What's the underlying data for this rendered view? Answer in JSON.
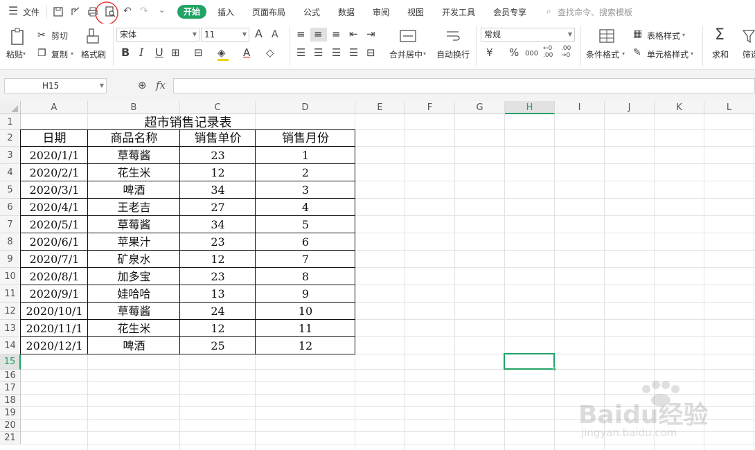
{
  "menubar": {
    "file_label": "文件",
    "tabs": [
      "开始",
      "插入",
      "页面布局",
      "公式",
      "数据",
      "审阅",
      "视图",
      "开发工具",
      "会员专享"
    ],
    "search_placeholder": "查找命令、搜索模板"
  },
  "ribbon": {
    "paste": "粘贴",
    "cut": "剪切",
    "copy": "复制",
    "format_painter": "格式刷",
    "font_name": "宋体",
    "font_size": "11",
    "bold": "B",
    "italic": "I",
    "underline": "U",
    "merge_center": "合并居中",
    "wrap_text": "自动换行",
    "number_format": "常规",
    "table_style": "表格样式",
    "cell_style": "单元格样式",
    "conditional_format": "条件格式",
    "sum": "求和",
    "filter": "筛选",
    "currency": "¥",
    "percent": "%",
    "thousands": "000",
    "dec_inc": "←0 .00",
    "dec_dec": ".00 →0",
    "font_grow": "A",
    "font_shrink": "A"
  },
  "formula_bar": {
    "name_box": "H15",
    "fx": "fx",
    "content": ""
  },
  "sheet": {
    "columns": [
      "A",
      "B",
      "C",
      "D",
      "E",
      "F",
      "G",
      "H",
      "I",
      "J",
      "K",
      "L"
    ],
    "rows": [
      "1",
      "2",
      "3",
      "4",
      "5",
      "6",
      "7",
      "8",
      "9",
      "10",
      "11",
      "12",
      "13",
      "14",
      "15",
      "16",
      "17",
      "18",
      "19",
      "20",
      "21"
    ],
    "active_cell": "H15",
    "title": "超市销售记录表",
    "headers": [
      "日期",
      "商品名称",
      "销售单价",
      "销售月份"
    ],
    "data": [
      [
        "2020/1/1",
        "草莓酱",
        "23",
        "1"
      ],
      [
        "2020/2/1",
        "花生米",
        "12",
        "2"
      ],
      [
        "2020/3/1",
        "啤酒",
        "34",
        "3"
      ],
      [
        "2020/4/1",
        "王老吉",
        "27",
        "4"
      ],
      [
        "2020/5/1",
        "草莓酱",
        "34",
        "5"
      ],
      [
        "2020/6/1",
        "苹果汁",
        "23",
        "6"
      ],
      [
        "2020/7/1",
        "矿泉水",
        "12",
        "7"
      ],
      [
        "2020/8/1",
        "加多宝",
        "23",
        "8"
      ],
      [
        "2020/9/1",
        "娃哈哈",
        "13",
        "9"
      ],
      [
        "2020/10/1",
        "草莓酱",
        "24",
        "10"
      ],
      [
        "2020/11/1",
        "花生米",
        "12",
        "11"
      ],
      [
        "2020/12/1",
        "啤酒",
        "25",
        "12"
      ]
    ]
  },
  "colors": {
    "accent": "#21a366",
    "annotation": "#e63b3b"
  },
  "watermark": {
    "brand": "Baidu经验",
    "url": "jingyan.baidu.com"
  }
}
